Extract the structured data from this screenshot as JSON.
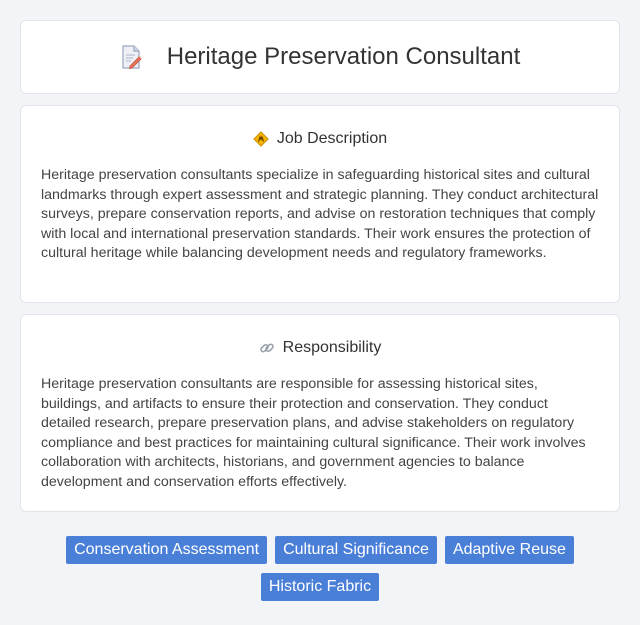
{
  "header": {
    "title": "Heritage Preservation Consultant",
    "icon": "document-pencil-icon"
  },
  "sections": [
    {
      "heading": "Job Description",
      "icon": "diamond-sign-icon",
      "body": "Heritage preservation consultants specialize in safeguarding historical sites and cultural landmarks through expert assessment and strategic planning. They conduct architectural surveys, prepare conservation reports, and advise on restoration techniques that comply with local and international preservation standards. Their work ensures the protection of cultural heritage while balancing development needs and regulatory frameworks."
    },
    {
      "heading": "Responsibility",
      "icon": "link-icon",
      "body": "Heritage preservation consultants are responsible for assessing historical sites, buildings, and artifacts to ensure their protection and conservation. They conduct detailed research, prepare preservation plans, and advise stakeholders on regulatory compliance and best practices for maintaining cultural significance. Their work involves collaboration with architects, historians, and government agencies to balance development and conservation efforts effectively."
    }
  ],
  "tags": [
    "Conservation Assessment",
    "Cultural Significance",
    "Adaptive Reuse",
    "Historic Fabric"
  ],
  "colors": {
    "background": "#f2f4f8",
    "card": "#ffffff",
    "tag": "#4a7fd8",
    "text": "#333333"
  }
}
